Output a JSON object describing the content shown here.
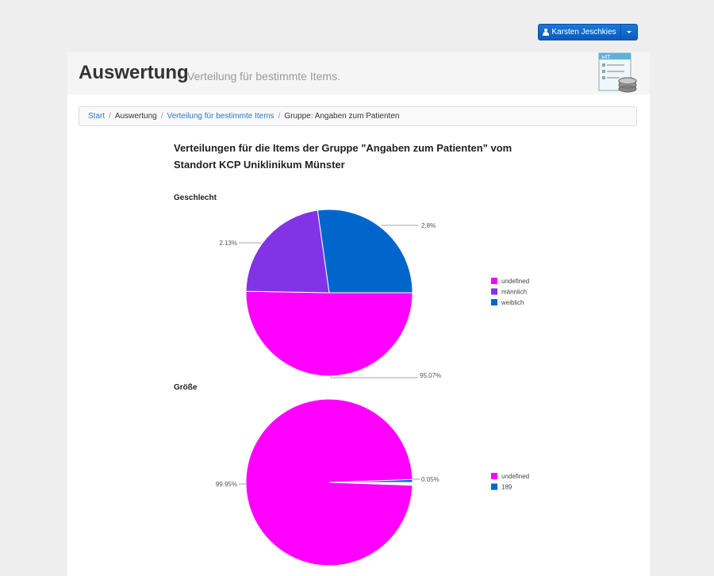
{
  "user_button": {
    "label": "Karsten Jeschkies",
    "icon": "user-icon",
    "dropdown_icon": "caret-down-icon"
  },
  "header": {
    "title": "Auswertung",
    "subtitle": "Verteilung für bestimmte Items.",
    "logo_text": "x4T"
  },
  "breadcrumb": {
    "items": [
      "Start",
      "Auswertung",
      "Verteilung für bestimmte Items",
      "Gruppe: Angaben zum Patienten"
    ],
    "separator": "/"
  },
  "report": {
    "title": "Verteilungen für die Items der Gruppe \"Angaben zum Patienten\" vom Standort KCP Uniklinikum Münster"
  },
  "colors": {
    "undefined": "#ff00ff",
    "maennlich": "#8133e5",
    "weiblich": "#0066cc",
    "primary": "#0a5cc1",
    "link": "#2a7ac0"
  },
  "chart_data": [
    {
      "type": "pie",
      "title": "Geschlecht",
      "series": [
        {
          "name": "undefined",
          "value": 95.07,
          "label": "95.07%",
          "color": "#ff00ff"
        },
        {
          "name": "männlich",
          "value": 2.13,
          "label": "2.13%",
          "color": "#8133e5"
        },
        {
          "name": "weiblich",
          "value": 2.8,
          "label": "2.8%",
          "color": "#0066cc"
        }
      ],
      "legend_position": "right"
    },
    {
      "type": "pie",
      "title": "Größe",
      "series": [
        {
          "name": "undefined",
          "value": 99.95,
          "label": "99.95%",
          "color": "#ff00ff"
        },
        {
          "name": "189",
          "value": 0.05,
          "label": "0.05%",
          "color": "#0066cc"
        }
      ],
      "legend_position": "right"
    }
  ]
}
